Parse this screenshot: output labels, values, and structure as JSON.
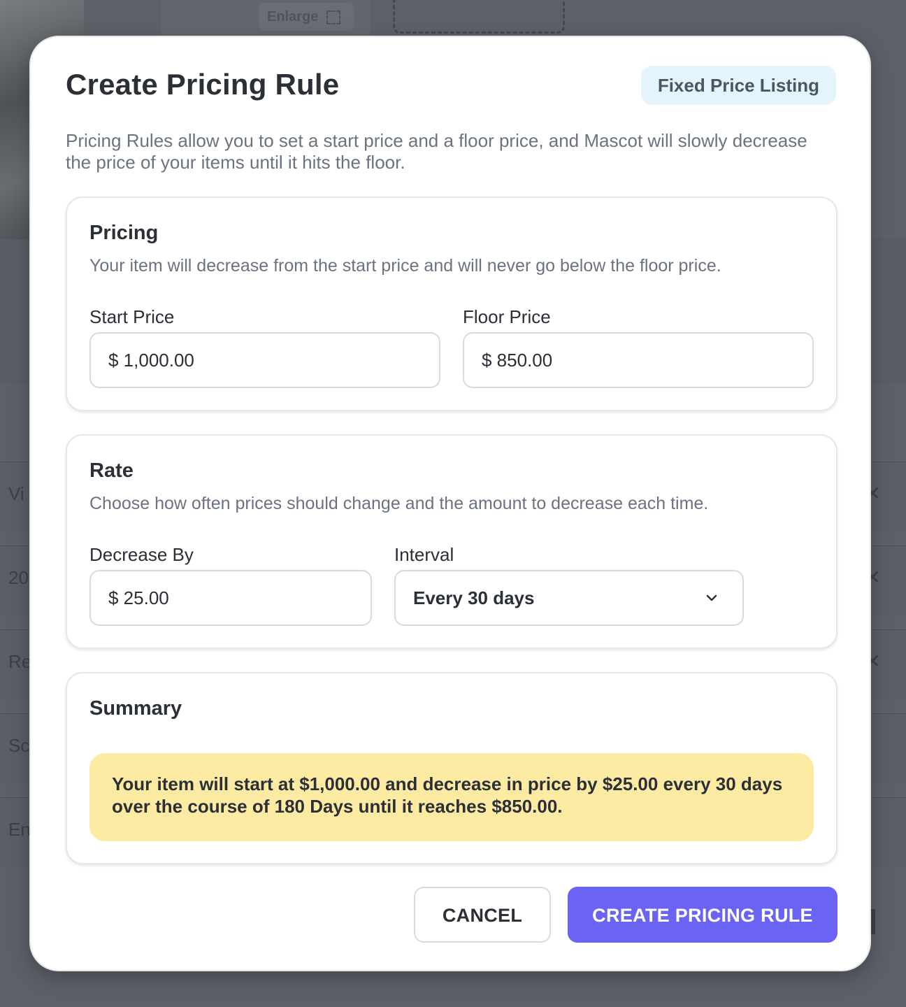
{
  "background": {
    "enlarge_label": "Enlarge",
    "rows": [
      "Vi",
      "20",
      "Re",
      "Sc",
      "En"
    ]
  },
  "modal": {
    "title": "Create Pricing Rule",
    "badge": "Fixed Price Listing",
    "description": "Pricing Rules allow you to set a start price and a floor price, and Mascot will slowly decrease the price of your items until it hits the floor."
  },
  "pricing": {
    "title": "Pricing",
    "subtitle": "Your item will decrease from the start price and will never go below the floor price.",
    "start_label": "Start Price",
    "start_value": "$ 1,000.00",
    "floor_label": "Floor Price",
    "floor_value": "$ 850.00"
  },
  "rate": {
    "title": "Rate",
    "subtitle": "Choose how often prices should change and the amount to decrease each time.",
    "decrease_label": "Decrease By",
    "decrease_value": "$ 25.00",
    "interval_label": "Interval",
    "interval_value": "Every 30 days"
  },
  "summary": {
    "title": "Summary",
    "text": "Your item will start at $1,000.00 and decrease in price by $25.00 every 30 days over the course of 180 Days until it reaches $850.00."
  },
  "actions": {
    "cancel": "CANCEL",
    "create": "CREATE PRICING RULE"
  },
  "colors": {
    "primary": "#6a63f4",
    "badge_bg": "#e3f4fc",
    "summary_bg": "#fdeaa3",
    "overlay": "#565b64"
  }
}
